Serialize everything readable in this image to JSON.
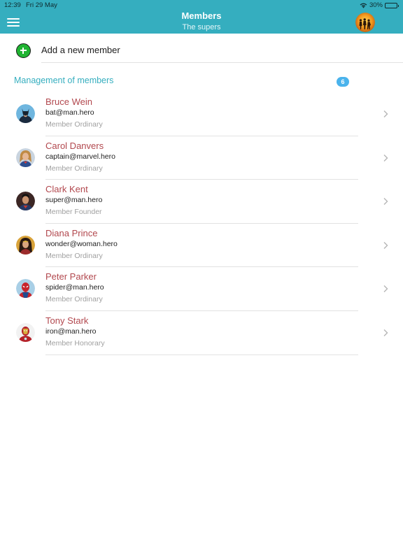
{
  "status_bar": {
    "time": "12:39",
    "date": "Fri 29 May",
    "battery": "30%",
    "battery_level": 0.3
  },
  "navbar": {
    "title": "Members",
    "subtitle": "The supers",
    "menu_icon": "hamburger-icon",
    "avatar_icon": "group-avatar"
  },
  "add_member": {
    "label": "Add a new member",
    "icon": "plus-circle-icon",
    "accent": "#20B432"
  },
  "section": {
    "title": "Management of members",
    "count": "6",
    "accent": "#35AEBF",
    "badge_color": "#4AB3EC"
  },
  "members": [
    {
      "name": "Bruce Wein",
      "email": "bat@man.hero",
      "role": "Member Ordinary",
      "avatar": "batman-avatar"
    },
    {
      "name": "Carol Danvers",
      "email": "captain@marvel.hero",
      "role": "Member Ordinary",
      "avatar": "captain-marvel-avatar"
    },
    {
      "name": "Clark Kent",
      "email": "super@man.hero",
      "role": "Member Founder",
      "avatar": "superman-avatar"
    },
    {
      "name": "Diana Prince",
      "email": "wonder@woman.hero",
      "role": "Member Ordinary",
      "avatar": "wonder-woman-avatar"
    },
    {
      "name": "Peter Parker",
      "email": "spider@man.hero",
      "role": "Member Ordinary",
      "avatar": "spiderman-avatar"
    },
    {
      "name": "Tony Stark",
      "email": "iron@man.hero",
      "role": "Member Honorary",
      "avatar": "iron-man-avatar"
    }
  ],
  "colors": {
    "header": "#35AEBF",
    "name": "#B2484E",
    "role": "#A0A0A0"
  }
}
